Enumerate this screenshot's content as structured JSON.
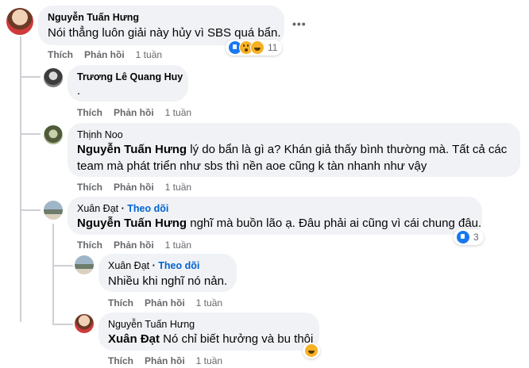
{
  "colors": {
    "bubble": "#f0f2f5",
    "secondary": "#65676b",
    "link": "#0064d1",
    "like": "#1877f2",
    "emoji": "#f7b125"
  },
  "comments": [
    {
      "author": "Nguyễn Tuấn Hưng",
      "text": "Nói thẳng luôn giải này hủy vì SBS quá bẩn.",
      "like_label": "Thích",
      "reply_label": "Phản hồi",
      "time": "1 tuần",
      "reactions": {
        "icons": [
          "like-icon",
          "wow-icon",
          "haha-icon"
        ],
        "count": "11"
      },
      "more_label": "•••"
    },
    {
      "author": "Trương Lê Quang Huy",
      "text": ".",
      "like_label": "Thích",
      "reply_label": "Phản hồi",
      "time": "1 tuần"
    },
    {
      "author": "Thịnh Noo",
      "mention": "Nguyễn Tuấn Hưng",
      "text": " lý do bẩn là gì a? Khán giả thấy bình thường mà. Tất cả các team mà phát triển như sbs thì nền aoe cũng k tàn nhanh như vậy",
      "like_label": "Thích",
      "reply_label": "Phản hồi",
      "time": "1 tuần"
    },
    {
      "author": "Xuân Đạt",
      "follow": "Theo dõi",
      "mention": "Nguyễn Tuấn Hưng",
      "text": " nghĩ mà buồn lão ạ. Đâu phải ai cũng vì cái chung đâu.",
      "like_label": "Thích",
      "reply_label": "Phản hồi",
      "time": "1 tuần",
      "reactions": {
        "icons": [
          "like-icon"
        ],
        "count": "3"
      }
    },
    {
      "author": "Xuân Đạt",
      "follow": "Theo dõi",
      "text": "Nhiều khi nghĩ nó nản.",
      "like_label": "Thích",
      "reply_label": "Phản hồi",
      "time": "1 tuần"
    },
    {
      "author": "Nguyễn Tuấn Hưng",
      "mention": "Xuân Đạt",
      "text": " Nó chỉ biết hưởng và bu thôi",
      "like_label": "Thích",
      "reply_label": "Phản hồi",
      "time": "1 tuần",
      "reactions": {
        "icons": [
          "haha-icon"
        ]
      }
    }
  ]
}
